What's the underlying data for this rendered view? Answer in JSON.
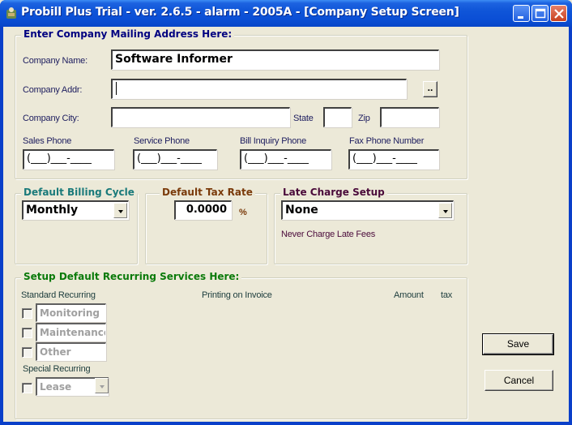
{
  "window": {
    "title": "Probill Plus Trial - ver. 2.6.5 - alarm - 2005A - [Company Setup Screen]",
    "icon": "app-icon",
    "controls": [
      "minimize-icon",
      "maximize-icon",
      "close-icon"
    ]
  },
  "mailing": {
    "group_title": "Enter Company Mailing Address Here:",
    "title_color": "#000080",
    "company_name_label": "Company Name:",
    "company_name_value": "Software Informer",
    "company_addr_label": "Company Addr:",
    "company_addr_value": "",
    "browse_label": "..",
    "company_city_label": "Company City:",
    "company_city_value": "",
    "state_label": "State",
    "state_value": "",
    "zip_label": "Zip",
    "zip_value": "",
    "phones": [
      {
        "label": "Sales Phone",
        "value": "(___)___-____"
      },
      {
        "label": "Service Phone",
        "value": "(___)___-____"
      },
      {
        "label": "Bill Inquiry Phone",
        "value": "(___)___-____"
      },
      {
        "label": "Fax Phone Number",
        "value": "(___)___-____"
      }
    ]
  },
  "billing": {
    "group_title": "Default Billing Cycle",
    "title_color": "#1a7a7a",
    "selected": "Monthly"
  },
  "tax": {
    "group_title": "Default Tax Rate",
    "title_color": "#7a3a0a",
    "value": "0.0000",
    "unit": "%"
  },
  "late_charge": {
    "group_title": "Late Charge Setup",
    "title_color": "#4a0a3a",
    "selected": "None",
    "description": "Never Charge Late Fees"
  },
  "recurring": {
    "group_title": "Setup Default Recurring Services Here:",
    "title_color": "#0a7a0a",
    "standard_label": "Standard Recurring",
    "printing_label": "Printing on Invoice",
    "amount_label": "Amount",
    "tax_label": "tax",
    "standard_items": [
      {
        "name": "Monitoring",
        "checked": false
      },
      {
        "name": "Maintenance",
        "checked": false
      },
      {
        "name": "Other",
        "checked": false
      }
    ],
    "special_label": "Special Recurring",
    "special_item": {
      "name": "Lease",
      "checked": false
    }
  },
  "actions": {
    "save_label": "Save",
    "cancel_label": "Cancel"
  }
}
